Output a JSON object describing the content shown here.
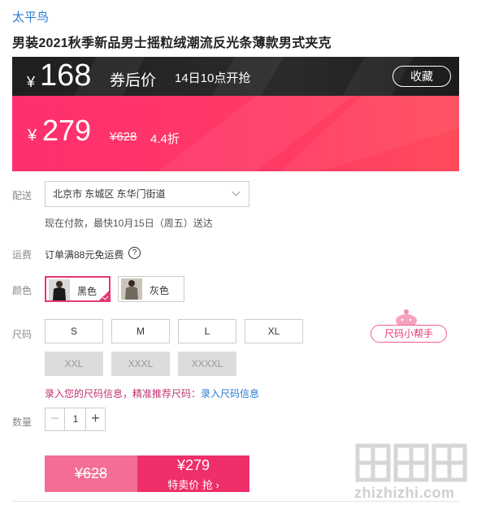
{
  "brand": "太平鸟",
  "title": "男装2021秋季新品男士摇粒绒潮流反光条薄款男式夹克",
  "promo": {
    "currency": "¥",
    "coupon_price": "168",
    "after_coupon_label": "券后价",
    "start_time": "14日10点开抢",
    "favorite_label": "收藏",
    "sale_price": "279",
    "original_price": "¥628",
    "discount": "4.4折"
  },
  "delivery": {
    "label": "配送",
    "address": "北京市 东城区 东华门街道",
    "estimate": "现在付款，最快10月15日（周五）送达"
  },
  "shipping": {
    "label": "运费",
    "text": "订单满88元免运费",
    "help_icon": "?"
  },
  "color": {
    "label": "颜色",
    "options": [
      {
        "name": "黑色",
        "selected": true
      },
      {
        "name": "灰色",
        "selected": false
      }
    ]
  },
  "size": {
    "label": "尺码",
    "available": [
      "S",
      "M",
      "L",
      "XL"
    ],
    "unavailable": [
      "XXL",
      "XXXL",
      "XXXXL"
    ],
    "helper_label": "尺码小帮手",
    "info_text": "录入您的尺码信息，精准推荐尺码：",
    "info_link": "录入尺码信息"
  },
  "quantity": {
    "label": "数量",
    "value": "1",
    "minus": "−",
    "plus": "+"
  },
  "buy": {
    "original_price": "¥628",
    "sale_price": "¥279",
    "action_label": "特卖价 抢 ›"
  },
  "watermark": {
    "text": "zhizhizhi.com",
    "logo_icon": "zhizhizhi-logo"
  },
  "colors": {
    "accent": "#ef2f6a",
    "link": "#2a7bd3",
    "dark_banner": "#222222"
  }
}
